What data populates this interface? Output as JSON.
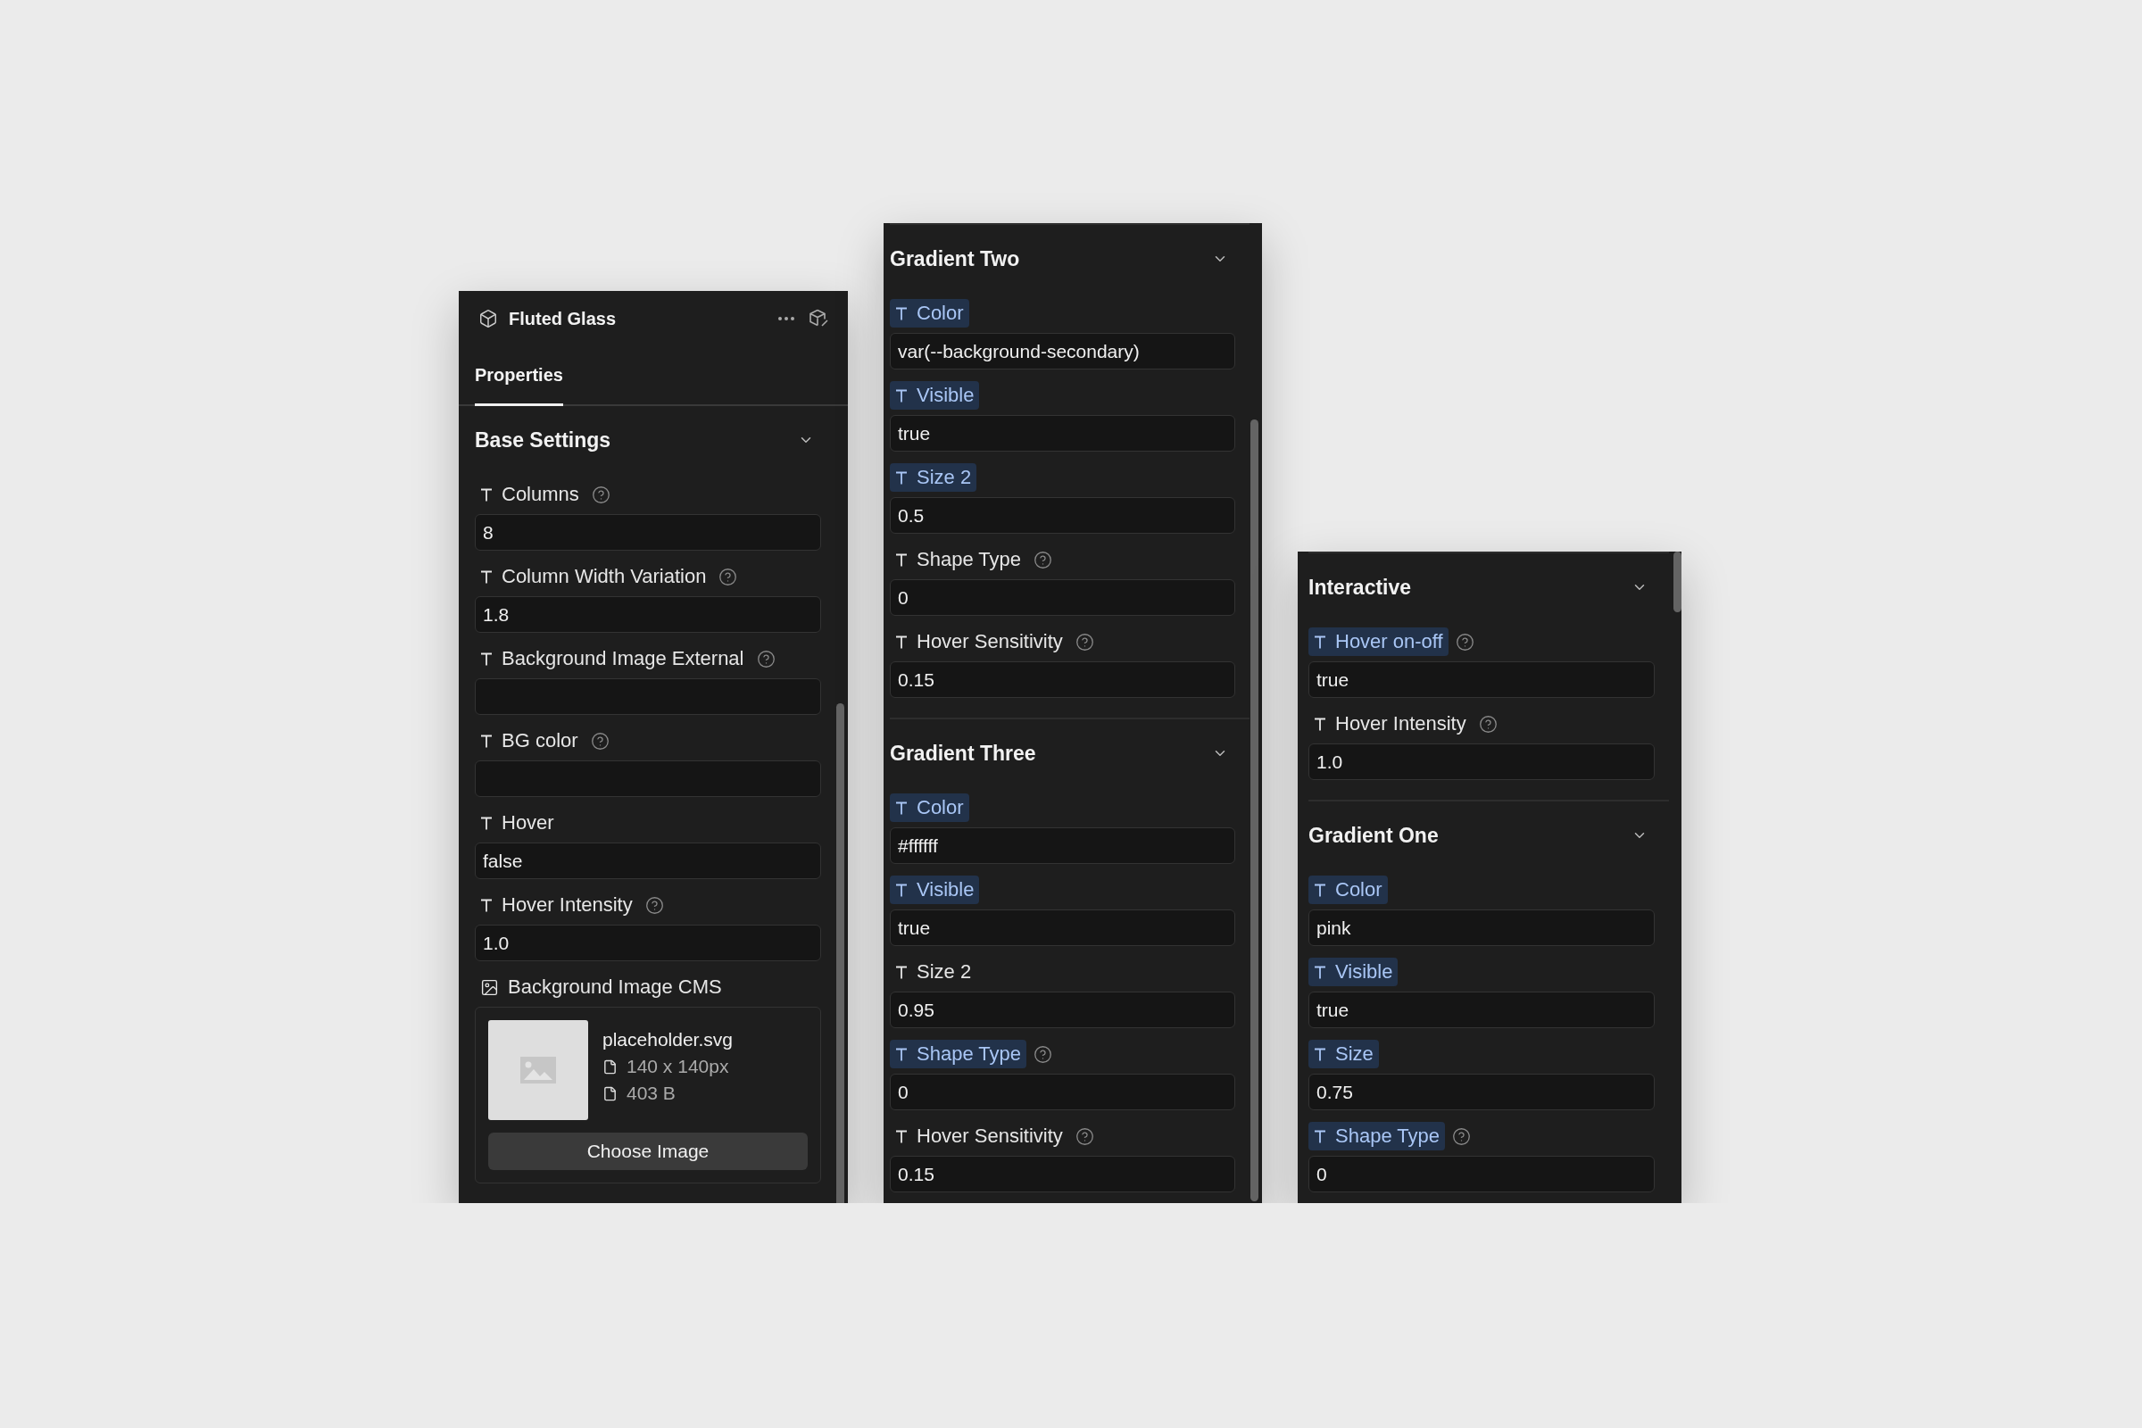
{
  "panels": [
    {
      "kind": "component",
      "title": "Fluted Glass",
      "tabs": [
        {
          "label": "Properties",
          "selected": true
        }
      ],
      "sections": [
        {
          "title": "Base Settings",
          "fields": [
            {
              "kind": "text",
              "label": "Columns",
              "help": true,
              "highlighted": false,
              "value": "8"
            },
            {
              "kind": "text",
              "label": "Column Width Variation",
              "help": true,
              "highlighted": false,
              "value": "1.8"
            },
            {
              "kind": "text",
              "label": "Background Image External",
              "help": true,
              "highlighted": false
            },
            {
              "kind": "text",
              "label": "BG color",
              "help": true,
              "highlighted": false
            },
            {
              "kind": "text",
              "label": "Hover",
              "help": false,
              "highlighted": false,
              "value": "false"
            },
            {
              "kind": "text",
              "label": "Hover Intensity",
              "help": true,
              "highlighted": false,
              "value": "1.0"
            },
            {
              "kind": "image",
              "label": "Background Image CMS",
              "file_name": "placeholder.svg",
              "dimensions": "140 x 140px",
              "file_size": "403 B",
              "button": "Choose Image"
            }
          ]
        }
      ]
    },
    {
      "kind": "scroll",
      "sections": [
        {
          "title": "Gradient Two",
          "fields": [
            {
              "kind": "text",
              "label": "Color",
              "help": false,
              "highlighted": true,
              "value": "var(--background-secondary)"
            },
            {
              "kind": "text",
              "label": "Visible",
              "help": false,
              "highlighted": true,
              "value": "true"
            },
            {
              "kind": "text",
              "label": "Size 2",
              "help": false,
              "highlighted": true,
              "value": "0.5"
            },
            {
              "kind": "text",
              "label": "Shape Type",
              "help": true,
              "highlighted": false,
              "value": "0"
            },
            {
              "kind": "text",
              "label": "Hover Sensitivity",
              "help": true,
              "highlighted": false,
              "value": "0.15"
            }
          ]
        },
        {
          "title": "Gradient Three",
          "fields": [
            {
              "kind": "text",
              "label": "Color",
              "help": false,
              "highlighted": true,
              "value": "#ffffff"
            },
            {
              "kind": "text",
              "label": "Visible",
              "help": false,
              "highlighted": true,
              "value": "true"
            },
            {
              "kind": "text",
              "label": "Size 2",
              "help": false,
              "highlighted": false,
              "value": "0.95"
            },
            {
              "kind": "text",
              "label": "Shape Type",
              "help": true,
              "highlighted": true,
              "value": "0"
            },
            {
              "kind": "text",
              "label": "Hover Sensitivity",
              "help": true,
              "highlighted": false,
              "value": "0.15"
            }
          ]
        }
      ]
    },
    {
      "kind": "scroll",
      "sections": [
        {
          "title": "Interactive",
          "fields": [
            {
              "kind": "text",
              "label": "Hover on-off",
              "help": true,
              "highlighted": true,
              "value": "true"
            },
            {
              "kind": "text",
              "label": "Hover Intensity",
              "help": true,
              "highlighted": false,
              "value": "1.0"
            }
          ]
        },
        {
          "title": "Gradient One",
          "fields": [
            {
              "kind": "text",
              "label": "Color",
              "help": false,
              "highlighted": true,
              "value": "pink"
            },
            {
              "kind": "text",
              "label": "Visible",
              "help": false,
              "highlighted": true,
              "value": "true"
            },
            {
              "kind": "text",
              "label": "Size",
              "help": false,
              "highlighted": true,
              "value": "0.75"
            },
            {
              "kind": "text",
              "label": "Shape Type",
              "help": true,
              "highlighted": true,
              "value": "0"
            }
          ]
        }
      ]
    }
  ]
}
